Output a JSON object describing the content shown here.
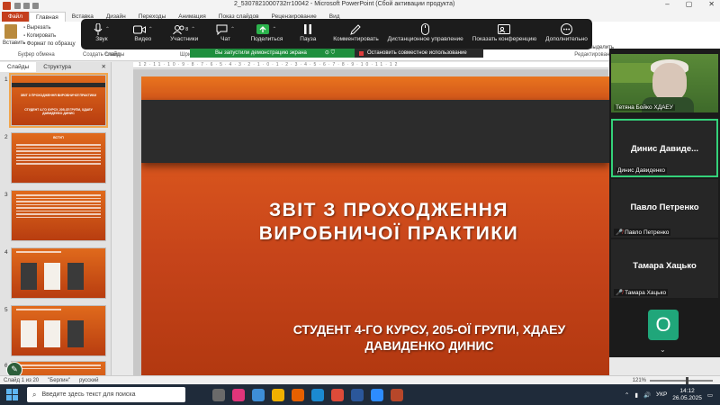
{
  "window": {
    "title": "2_5307821000732гг10042 - Microsoft PowerPoint (Сбой активации продукта)",
    "controls": [
      "–",
      "▢",
      "✕"
    ]
  },
  "ribbon_tabs": [
    "Файл",
    "Главная",
    "Вставка",
    "Дизайн",
    "Переходы",
    "Анимация",
    "Показ слайдов",
    "Рецензирование",
    "Вид"
  ],
  "ribbon": {
    "paste_label": "Вставить",
    "clipboard_items": [
      "Вырезать",
      "Копировать",
      "Формат по образцу"
    ],
    "clipboard_group": "Буфер обмена",
    "slides_group": "Слайды",
    "font_group": "Шриф",
    "create_slide": "Создать слайд",
    "select_item": "Выделить",
    "editing_group": "Редактирование"
  },
  "zoom_toolbar": {
    "buttons": [
      {
        "label": "Звук",
        "icon": "microphone-icon"
      },
      {
        "label": "Видео",
        "icon": "video-camera-icon"
      },
      {
        "label": "Участники",
        "icon": "participants-icon",
        "count": "8"
      },
      {
        "label": "Чат",
        "icon": "chat-icon"
      },
      {
        "label": "Поделиться",
        "icon": "share-screen-icon"
      },
      {
        "label": "Пауза",
        "icon": "pause-icon"
      },
      {
        "label": "Комментировать",
        "icon": "annotate-pen-icon"
      },
      {
        "label": "Дистанционное управление",
        "icon": "remote-control-mouse-icon"
      },
      {
        "label": "Показать конференцию",
        "icon": "show-meeting-icon"
      },
      {
        "label": "Дополнительно",
        "icon": "more-icon"
      }
    ],
    "sharing_notice": "Вы запустили демонстрацию экрана",
    "stop_share": "Остановить совместное использование"
  },
  "left_panel": {
    "tabs": [
      "Слайды",
      "Структура"
    ],
    "close": "✕",
    "slide_numbers": [
      "1",
      "2",
      "3",
      "4",
      "5",
      "6"
    ],
    "slide1_title": "ЗВІТ З ПРОХОДЖЕННЯ ВИРОБНИЧОЇ ПРАКТИКИ",
    "slide1_sub": "СТУДЕНТ 4-ГО КУРСУ, 205-ОЇ ГРУПИ, ХДАЕУ ДАВИДЕНКО ДИНИС",
    "slide2_heading": "ВСТУП"
  },
  "slide": {
    "title_line1": "ЗВІТ З ПРОХОДЖЕННЯ",
    "title_line2": "ВИРОБНИЧОЇ ПРАКТИКИ",
    "subtitle_line1": "СТУДЕНТ 4-ГО КУРСУ, 205-ОЇ ГРУПИ, ХДАЕУ",
    "subtitle_line2": "ДАВИДЕНКО ДИНИС"
  },
  "participants": {
    "video_name": "Тетяна Бойко ХДАЕУ",
    "active_center": "Динис Давиде...",
    "active_name": "Динис Давиденко",
    "p3_center": "Павло Петренко",
    "p3_name": "Павло Петренко",
    "p4_center": "Тамара Хацько",
    "p4_name": "Тамара Хацько",
    "avatar_letter": "O",
    "scroll": "⌄"
  },
  "status_bar": {
    "slide_info": "Слайд 1 из 20",
    "theme": "\"Берлин\"",
    "language": "русский",
    "zoom": "121%"
  },
  "taskbar": {
    "search_placeholder": "Введите здесь текст для поиска",
    "lang": "УКР",
    "time": "14:12",
    "date": "26.05.2025"
  },
  "colors": {
    "powerpoint_accent": "#c43e1c",
    "zoom_share_green": "#2bb24c",
    "active_speaker_border": "#34d27a",
    "slide_orange": "#ea6420"
  }
}
